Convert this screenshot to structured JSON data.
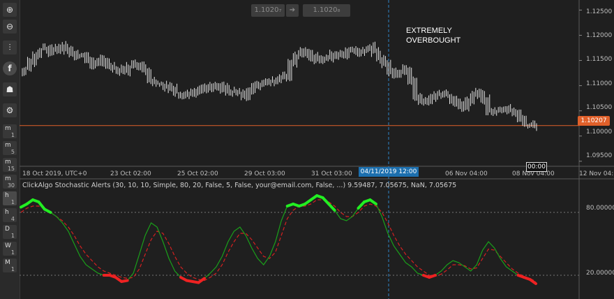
{
  "toolbar": {
    "tools": [
      {
        "icon": "zoom-in-icon",
        "glyph": "⊕"
      },
      {
        "icon": "zoom-out-icon",
        "glyph": "⊖"
      },
      {
        "icon": "candlestick-icon",
        "glyph": "⫶"
      },
      {
        "icon": "facebook-icon",
        "glyph": "f"
      },
      {
        "icon": "people-icon",
        "glyph": "☗"
      },
      {
        "icon": "settings-icon",
        "glyph": "⚙"
      }
    ],
    "timeframes": [
      {
        "a": "m",
        "b": "1"
      },
      {
        "a": "m",
        "b": "5"
      },
      {
        "a": "m",
        "b": "15"
      },
      {
        "a": "m",
        "b": "30"
      },
      {
        "a": "h",
        "b": "1",
        "active": true
      },
      {
        "a": "h",
        "b": "4"
      },
      {
        "a": "D",
        "b": "1"
      },
      {
        "a": "W",
        "b": "1"
      },
      {
        "a": "M",
        "b": "1"
      }
    ]
  },
  "quick_trade": {
    "sell_price": "1.1020₇",
    "buy_price": "1.1020₈",
    "arrow_glyph": "➔"
  },
  "annotation": {
    "line1": "EXTREMELY",
    "line2": "OVERBOUGHT"
  },
  "price_axis": [
    "1.12500",
    "1.12000",
    "1.11500",
    "1.11000",
    "1.10500",
    "1.10000",
    "1.09500"
  ],
  "current_price": "1.10207",
  "time_axis": [
    "18 Oct 2019, UTC+0",
    "23 Oct 02:00",
    "25 Oct 02:00",
    "29 Oct 03:00",
    "31 Oct 03:00",
    "06 Nov 04:00",
    "08 Nov 04:00",
    "12 Nov 04:"
  ],
  "cursor_time": "04/11/2019 12:00",
  "bar_timer": "00:00",
  "indicator": {
    "title": "ClickAlgo Stochastic Alerts (30, 10, 10, Simple, 80, 20, False, 5, False, your@email.com, False, ...) 9.59487, 7.05675, NaN, 7.05675",
    "levels": [
      "80.00000",
      "20.00000"
    ]
  },
  "colors": {
    "accent": "#e0602a",
    "cursor": "#1c6fae",
    "overbought": "#22ee22",
    "oversold": "#ee2222",
    "k_line": "#1aa01a",
    "d_line": "#d42020"
  },
  "chart_data": [
    {
      "type": "candlestick",
      "x_range": [
        "18 Oct 2019",
        "12 Nov 2019"
      ],
      "ylim": [
        1.094,
        1.127
      ],
      "close": [
        1.1132,
        1.1148,
        1.1162,
        1.117,
        1.1176,
        1.1168,
        1.1172,
        1.118,
        1.117,
        1.1164,
        1.116,
        1.1158,
        1.115,
        1.114,
        1.1145,
        1.115,
        1.1138,
        1.1135,
        1.1128,
        1.113,
        1.114,
        1.1145,
        1.1142,
        1.113,
        1.111,
        1.1105,
        1.1104,
        1.1098,
        1.1094,
        1.1086,
        1.108,
        1.1082,
        1.1085,
        1.1088,
        1.1092,
        1.109,
        1.1098,
        1.11,
        1.1095,
        1.109,
        1.1088,
        1.1085,
        1.108,
        1.1092,
        1.11,
        1.1105,
        1.1108,
        1.1112,
        1.111,
        1.1116,
        1.112,
        1.1145,
        1.116,
        1.1168,
        1.1165,
        1.1158,
        1.1152,
        1.115,
        1.1155,
        1.116,
        1.1162,
        1.1158,
        1.117,
        1.1172,
        1.1168,
        1.117,
        1.1175,
        1.1165,
        1.1155,
        1.1145,
        1.113,
        1.112,
        1.1128,
        1.1135,
        1.111,
        1.1075,
        1.107,
        1.1072,
        1.1078,
        1.1083,
        1.1086,
        1.108,
        1.107,
        1.1062,
        1.1058,
        1.107,
        1.1082,
        1.1088,
        1.107,
        1.105,
        1.1048,
        1.1052,
        1.1054,
        1.105,
        1.1045,
        1.103,
        1.1022,
        1.102,
        1.1021
      ]
    },
    {
      "type": "line",
      "ylim": [
        0,
        100
      ],
      "levels": [
        80,
        20
      ],
      "series": [
        {
          "values": [
            85,
            88,
            92,
            90,
            83,
            80,
            76,
            70,
            62,
            50,
            38,
            30,
            26,
            22,
            20,
            20,
            18,
            14,
            15,
            22,
            40,
            58,
            70,
            66,
            52,
            36,
            24,
            18,
            15,
            14,
            13,
            17,
            22,
            28,
            38,
            52,
            62,
            66,
            58,
            46,
            36,
            30,
            38,
            52,
            72,
            86,
            88,
            86,
            88,
            92,
            96,
            94,
            88,
            82,
            74,
            72,
            76,
            84,
            90,
            92,
            88,
            76,
            60,
            48,
            40,
            32,
            28,
            22,
            20,
            18,
            20,
            24,
            30,
            34,
            32,
            28,
            24,
            30,
            44,
            52,
            46,
            36,
            28,
            24,
            20,
            18,
            16,
            12
          ]
        },
        {
          "values": [
            80,
            84,
            86,
            86,
            84,
            80,
            76,
            72,
            66,
            58,
            48,
            40,
            34,
            28,
            24,
            22,
            20,
            18,
            17,
            18,
            26,
            40,
            54,
            62,
            60,
            50,
            38,
            28,
            22,
            18,
            16,
            15,
            18,
            22,
            30,
            42,
            52,
            60,
            60,
            54,
            46,
            38,
            36,
            42,
            58,
            74,
            82,
            86,
            86,
            88,
            92,
            92,
            90,
            86,
            80,
            76,
            76,
            80,
            86,
            88,
            86,
            80,
            70,
            58,
            48,
            40,
            34,
            28,
            24,
            20,
            19,
            21,
            25,
            30,
            30,
            29,
            26,
            27,
            36,
            45,
            44,
            38,
            32,
            26,
            22,
            19,
            17,
            14
          ]
        }
      ]
    }
  ]
}
